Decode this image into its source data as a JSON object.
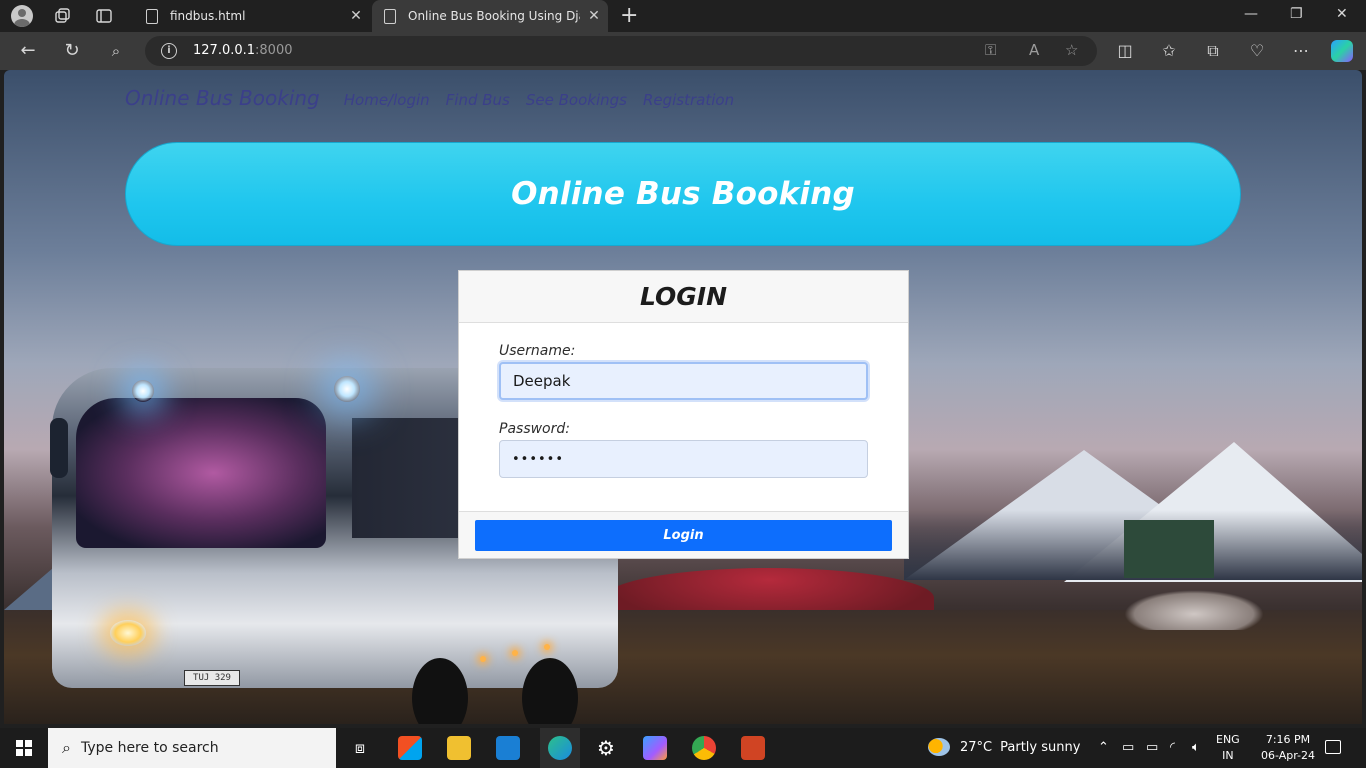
{
  "browser": {
    "tabs": [
      {
        "title": "findbus.html",
        "active": false
      },
      {
        "title": "Online Bus Booking Using Djang",
        "active": true
      }
    ],
    "url": {
      "host": "127.0.0.1",
      "port": ":8000"
    },
    "icons": [
      "profile-icon",
      "workspaces-icon",
      "tab-actions-icon",
      "back-icon",
      "refresh-icon",
      "search-icon",
      "info-icon",
      "key-icon",
      "read-aloud-icon",
      "favorite-icon",
      "split-screen-icon",
      "favorites-icon",
      "collections-icon",
      "browser-essentials-icon",
      "more-icon",
      "copilot-icon"
    ]
  },
  "site": {
    "brand": "Online Bus Booking",
    "nav": [
      "Home/login",
      "Find Bus",
      "See Bookings",
      "Registration"
    ],
    "hero_title": "Online Bus Booking",
    "login": {
      "heading": "LOGIN",
      "username_label": "Username:",
      "username_value": "Deepak",
      "password_label": "Password:",
      "password_value": "••••••",
      "button": "Login"
    },
    "bus_plate": "TUJ 329",
    "colors": {
      "hero": "#1fc6ee",
      "button": "#0d6efd",
      "nav_text": "#3b3f8a"
    }
  },
  "taskbar": {
    "search_placeholder": "Type here to search",
    "weather": {
      "temp": "27°C",
      "condition": "Partly sunny"
    },
    "lang": [
      "ENG",
      "IN"
    ],
    "time": "7:16 PM",
    "date": "06-Apr-24"
  }
}
